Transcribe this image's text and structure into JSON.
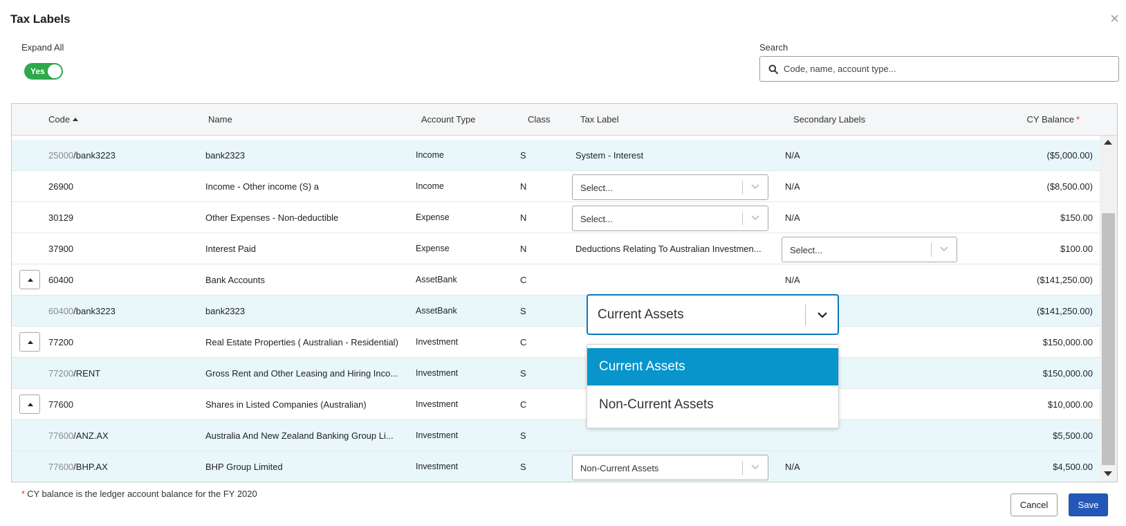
{
  "dialog": {
    "title": "Tax Labels",
    "close_glyph": "×"
  },
  "expand_all": {
    "label": "Expand All",
    "toggle_text": "Yes"
  },
  "search": {
    "label": "Search",
    "placeholder": "Code, name, account type..."
  },
  "table": {
    "headers": {
      "code": "Code",
      "name": "Name",
      "account_type": "Account Type",
      "class": "Class",
      "tax_label": "Tax Label",
      "secondary_labels": "Secondary Labels",
      "cy_balance": "CY Balance",
      "required_marker": "*"
    },
    "rows": [
      {
        "code_parent": "25000",
        "code_sub": "/bank3223",
        "name": "bank2323",
        "account_type": "Income",
        "class": "S",
        "tax_label": "System - Interest",
        "secondary": "N/A",
        "balance": "($5,000.00)"
      },
      {
        "code": "26900",
        "name": "Income - Other income (S) a",
        "account_type": "Income",
        "class": "N",
        "tax_select": "Select...",
        "secondary": "N/A",
        "balance": "($8,500.00)"
      },
      {
        "code": "30129",
        "name": "Other Expenses - Non-deductible",
        "account_type": "Expense",
        "class": "N",
        "tax_select": "Select...",
        "secondary": "N/A",
        "balance": "$150.00"
      },
      {
        "code": "37900",
        "name": "Interest Paid",
        "account_type": "Expense",
        "class": "N",
        "tax_label": "Deductions Relating To Australian Investmen...",
        "secondary_select": "Select...",
        "balance": "$100.00"
      },
      {
        "code": "60400",
        "name": "Bank Accounts",
        "account_type": "AssetBank",
        "class": "C",
        "secondary": "N/A",
        "balance": "($141,250.00)"
      },
      {
        "code_parent": "60400",
        "code_sub": "/bank3223",
        "name": "bank2323",
        "account_type": "AssetBank",
        "class": "S",
        "balance": "($141,250.00)"
      },
      {
        "code": "77200",
        "name": "Real Estate Properties ( Australian - Residential)",
        "account_type": "Investment",
        "class": "C",
        "balance": "$150,000.00"
      },
      {
        "code_parent": "77200",
        "code_sub": "/RENT",
        "name": "Gross Rent and Other Leasing and Hiring Inco...",
        "account_type": "Investment",
        "class": "S",
        "balance": "$150,000.00"
      },
      {
        "code": "77600",
        "name": "Shares in Listed Companies (Australian)",
        "account_type": "Investment",
        "class": "C",
        "balance": "$10,000.00"
      },
      {
        "code_parent": "77600",
        "code_sub": "/ANZ.AX",
        "name": "Australia And New Zealand Banking Group Li...",
        "account_type": "Investment",
        "class": "S",
        "balance": "$5,500.00"
      },
      {
        "code_parent": "77600",
        "code_sub": "/BHP.AX",
        "name": "BHP Group Limited",
        "account_type": "Investment",
        "class": "S",
        "tax_select": "Non-Current Assets",
        "secondary": "N/A",
        "balance": "$4,500.00"
      }
    ]
  },
  "open_dropdown": {
    "value": "Current Assets",
    "options": [
      "Current Assets",
      "Non-Current Assets"
    ]
  },
  "footer": {
    "required_marker": "*",
    "note": "CY balance is the ledger account balance for the FY 2020",
    "cancel_label": "Cancel",
    "save_label": "Save"
  },
  "colors": {
    "toggle_on": "#2ea84a",
    "child_row_bg": "#e9f7fb",
    "dropdown_focus": "#0b78b8",
    "option_active": "#0795cc",
    "save_button": "#2458b8",
    "required": "#d9342b"
  }
}
